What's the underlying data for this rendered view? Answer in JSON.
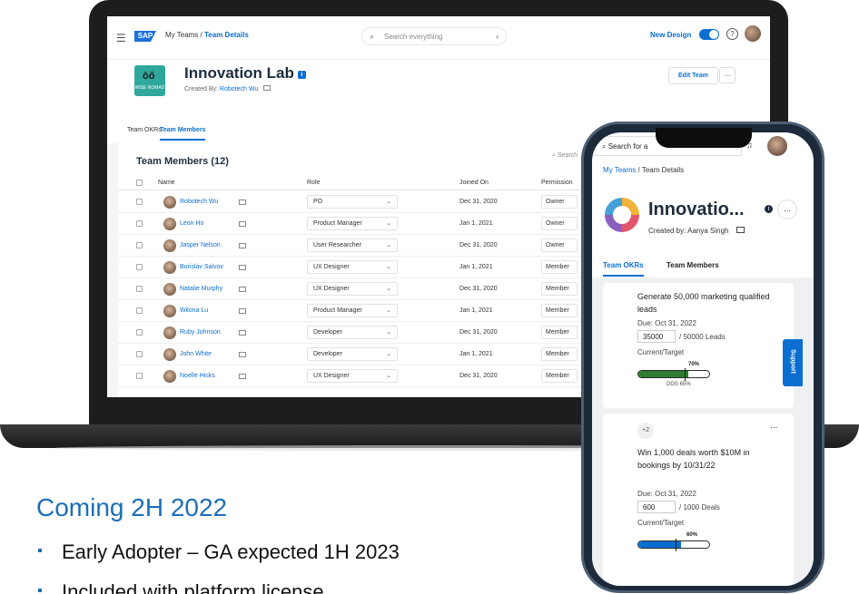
{
  "laptop": {
    "breadcrumb": {
      "root": "My Teams",
      "separator": "/",
      "current": "Team Details"
    },
    "search_placeholder": "Search everything",
    "new_design_label": "New Design",
    "team": {
      "name": "Innovation Lab",
      "info_badge": "i",
      "logo_caption": "WISE NOMAD",
      "created_by_label": "Created By:",
      "created_by_name": "Robotech Wu",
      "edit_button": "Edit Team",
      "more_button": "..."
    },
    "tabs": [
      "Team OKRs",
      "Team Members"
    ],
    "members": {
      "title": "Team Members (12)",
      "search_placeholder": "Search",
      "columns": [
        "Name",
        "Role",
        "Joined On",
        "Permission"
      ],
      "rows": [
        {
          "name": "Robotech Wu",
          "role": "PO",
          "joined": "Dec 31, 2020",
          "permission": "Owner"
        },
        {
          "name": "Leon Ho",
          "role": "Product Manager",
          "joined": "Jan 1, 2021",
          "permission": "Owner"
        },
        {
          "name": "Jasper Nelson",
          "role": "User Researcher",
          "joined": "Dec 31, 2020",
          "permission": "Owner"
        },
        {
          "name": "Borislav Salvov",
          "role": "UX Designer",
          "joined": "Jan 1, 2021",
          "permission": "Member"
        },
        {
          "name": "Natalie Murphy",
          "role": "UX Designer",
          "joined": "Dec 31, 2020",
          "permission": "Member"
        },
        {
          "name": "Wilona Lu",
          "role": "Product Manager",
          "joined": "Jan 1, 2021",
          "permission": "Member"
        },
        {
          "name": "Ruby Johnson",
          "role": "Developer",
          "joined": "Dec 31, 2020",
          "permission": "Member"
        },
        {
          "name": "John White",
          "role": "Developer",
          "joined": "Jan 1, 2021",
          "permission": "Member"
        },
        {
          "name": "Noelle Hicks",
          "role": "UX Designer",
          "joined": "Dec 31, 2020",
          "permission": "Member"
        }
      ]
    }
  },
  "phone": {
    "search_placeholder": "Search for a",
    "breadcrumb": {
      "root": "My Teams",
      "separator": "/",
      "current": "Team Details"
    },
    "team_title": "Innovatio...",
    "info_badge": "i",
    "more_button": "...",
    "created_by_label": "Created by:",
    "created_by_name": "Aanya Singh",
    "tabs": [
      "Team OKRs",
      "Team Members"
    ],
    "okrs": [
      {
        "title": "Generate 50,000 marketing qualified leads",
        "due": "Due: Oct 31, 2022",
        "current": "35000",
        "target": "/ 50000 Leads",
        "current_target_label": "Current/Target",
        "progress_label": "70%",
        "progress": 0.7,
        "dos_label": "DOS 65%",
        "bar_color": "#2e7d32"
      },
      {
        "badge": "+2",
        "more": "...",
        "title": "Win 1,000 deals worth $10M in bookings by 10/31/22",
        "due": "Due: Oct 31, 2022",
        "current": "600",
        "target": "/ 1000 Deals",
        "current_target_label": "Current/Target",
        "progress_label": "60%",
        "progress": 0.6,
        "bar_color": "#0a6ed1"
      }
    ],
    "support_tab": "Support"
  },
  "marketing": {
    "heading": "Coming 2H 2022",
    "bullets": [
      "Early Adopter – GA expected 1H 2023",
      "Included with platform license"
    ]
  },
  "colors": {
    "accent": "#0a6ed1",
    "heading": "#1c6fb7",
    "okr_green": "#2e7d32"
  }
}
